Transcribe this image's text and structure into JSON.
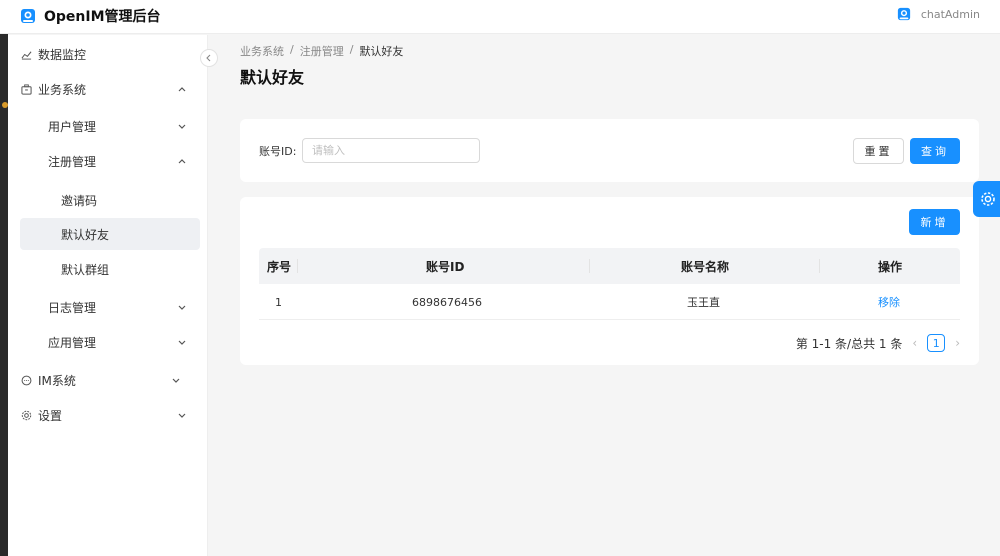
{
  "header": {
    "app_title": "OpenIM管理后台",
    "user_name": "chatAdmin"
  },
  "sidebar": {
    "items": [
      {
        "label": "数据监控",
        "icon": "line-chart-icon"
      },
      {
        "label": "业务系统",
        "icon": "briefcase-icon"
      },
      {
        "label": "用户管理"
      },
      {
        "label": "注册管理"
      },
      {
        "label": "邀请码"
      },
      {
        "label": "默认好友"
      },
      {
        "label": "默认群组"
      },
      {
        "label": "日志管理"
      },
      {
        "label": "应用管理"
      },
      {
        "label": "IM系统",
        "icon": "message-icon"
      },
      {
        "label": "设置",
        "icon": "gear-icon"
      }
    ]
  },
  "breadcrumb": [
    "业务系统",
    "注册管理",
    "默认好友"
  ],
  "breadcrumb_sep": "/",
  "page_title": "默认好友",
  "filter": {
    "label": "账号ID:",
    "placeholder": "请输入",
    "reset_label": "重置",
    "query_label": "查询"
  },
  "table": {
    "add_label": "新增",
    "columns": [
      "序号",
      "账号ID",
      "账号名称",
      "操作"
    ],
    "rows": [
      {
        "index": "1",
        "account_id": "6898676456",
        "account_name": "玉王直",
        "action": "移除"
      }
    ]
  },
  "pagination": {
    "summary": "第 1-1 条/总共 1 条",
    "current_page": "1"
  },
  "colors": {
    "primary": "#1890ff",
    "active_menu_bg": "#eef0f3"
  }
}
